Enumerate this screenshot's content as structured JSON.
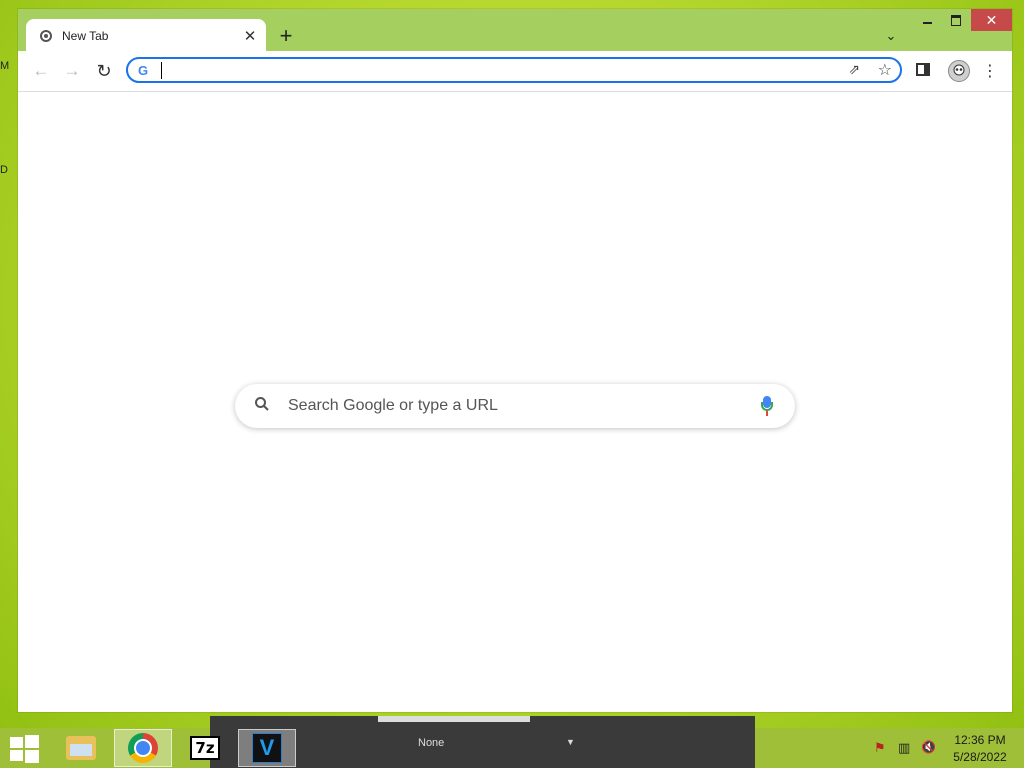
{
  "desktop": {
    "glyph_top": "M",
    "glyph_mid": "D"
  },
  "browser": {
    "tab": {
      "title": "New Tab",
      "close": "✕"
    },
    "new_tab": "+",
    "tab_search": "⌄",
    "window_close": "✕",
    "nav": {
      "back": "←",
      "forward": "→",
      "reload": "↻"
    },
    "omnibox": {
      "g_icon": "G",
      "value": "",
      "share": "⇗",
      "star": "☆"
    },
    "menu": "⋮",
    "ntp": {
      "search_placeholder": "Search Google or type a URL"
    }
  },
  "taskbar": {
    "ghost": {
      "dropdown_text": "None",
      "dropdown_caret": "▼"
    },
    "items": [
      "file-explorer",
      "chrome",
      "7-zip",
      "v-app"
    ],
    "sevenzip_label": "7z",
    "v_label": "V",
    "clock": {
      "time": "12:36 PM",
      "date": "5/28/2022"
    },
    "tray": {
      "flag": "⚑",
      "network": "▥",
      "volume": "🔇"
    }
  },
  "colors": {
    "accent": "#1a73e8",
    "close_button": "#c74a4a",
    "frame": "#a5cf5e"
  }
}
